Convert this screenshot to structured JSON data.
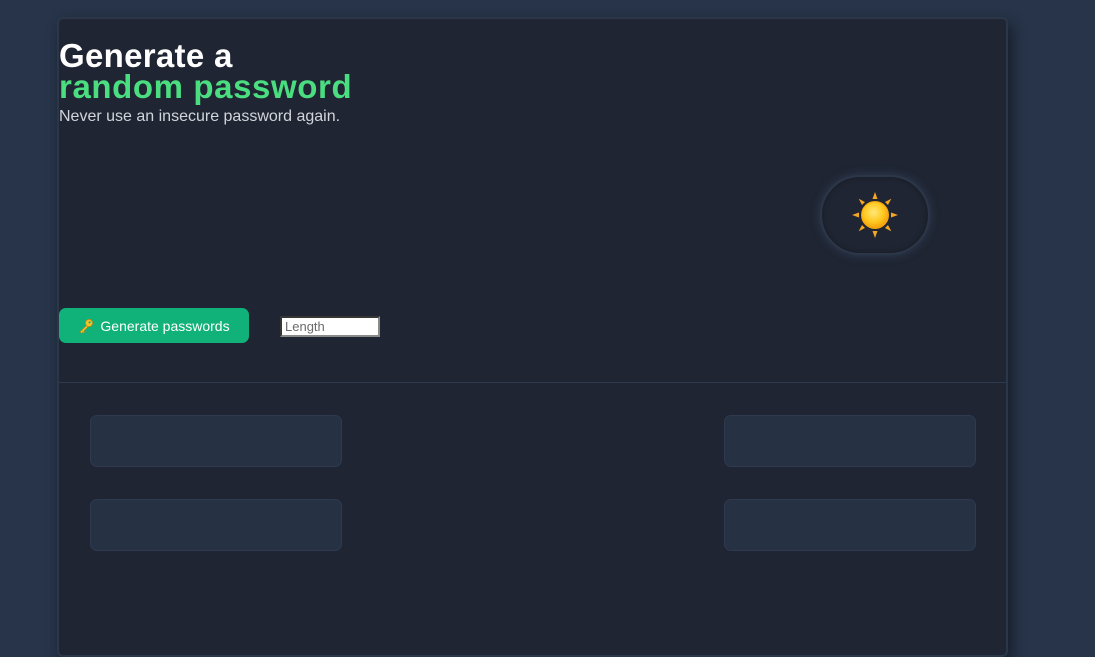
{
  "header": {
    "title_line1": "Generate a",
    "title_line2": "random password",
    "subtitle": "Never use an insecure password again."
  },
  "theme_toggle": {
    "icon": "sun-icon",
    "mode": "dark"
  },
  "controls": {
    "generate_label": "Generate passwords",
    "generate_icon": "key-icon",
    "length_placeholder": "Length",
    "length_value": ""
  },
  "passwords": [
    "",
    "",
    "",
    ""
  ],
  "colors": {
    "background": "#273449",
    "card": "#1f2532",
    "accent_green": "#4ade80",
    "button_green": "#10b27a",
    "password_box": "#273144"
  }
}
